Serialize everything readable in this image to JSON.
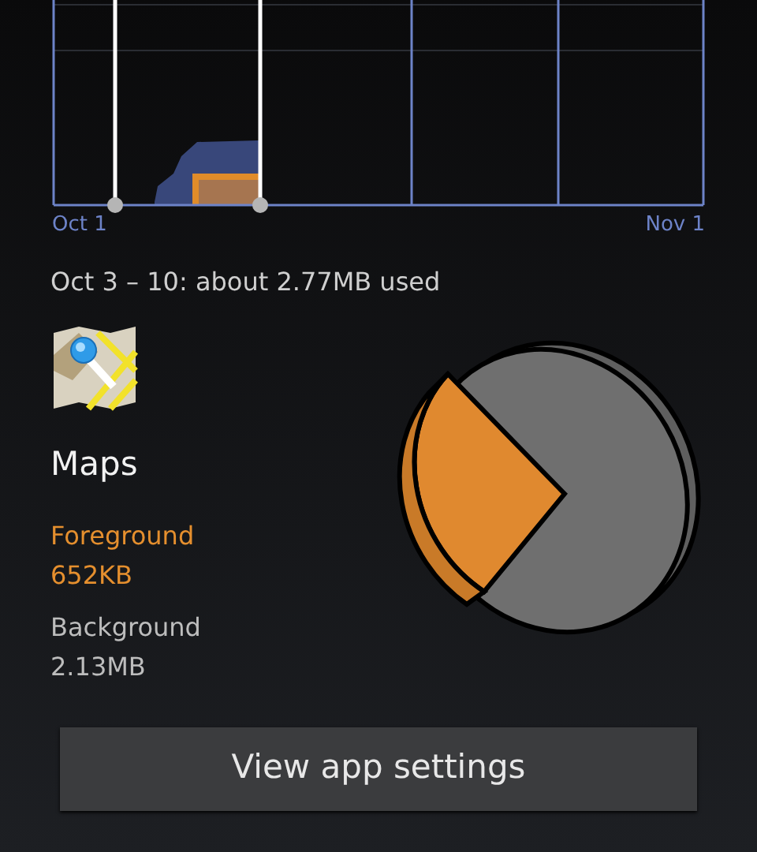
{
  "usage_chart": {
    "start_label": "Oct 1",
    "end_label": "Nov 1"
  },
  "summary": "Oct 3 – 10: about 2.77MB used",
  "app": {
    "name": "Maps"
  },
  "foreground": {
    "label": "Foreground",
    "value": "652KB"
  },
  "background": {
    "label": "Background",
    "value": "2.13MB"
  },
  "button": "View app settings"
}
